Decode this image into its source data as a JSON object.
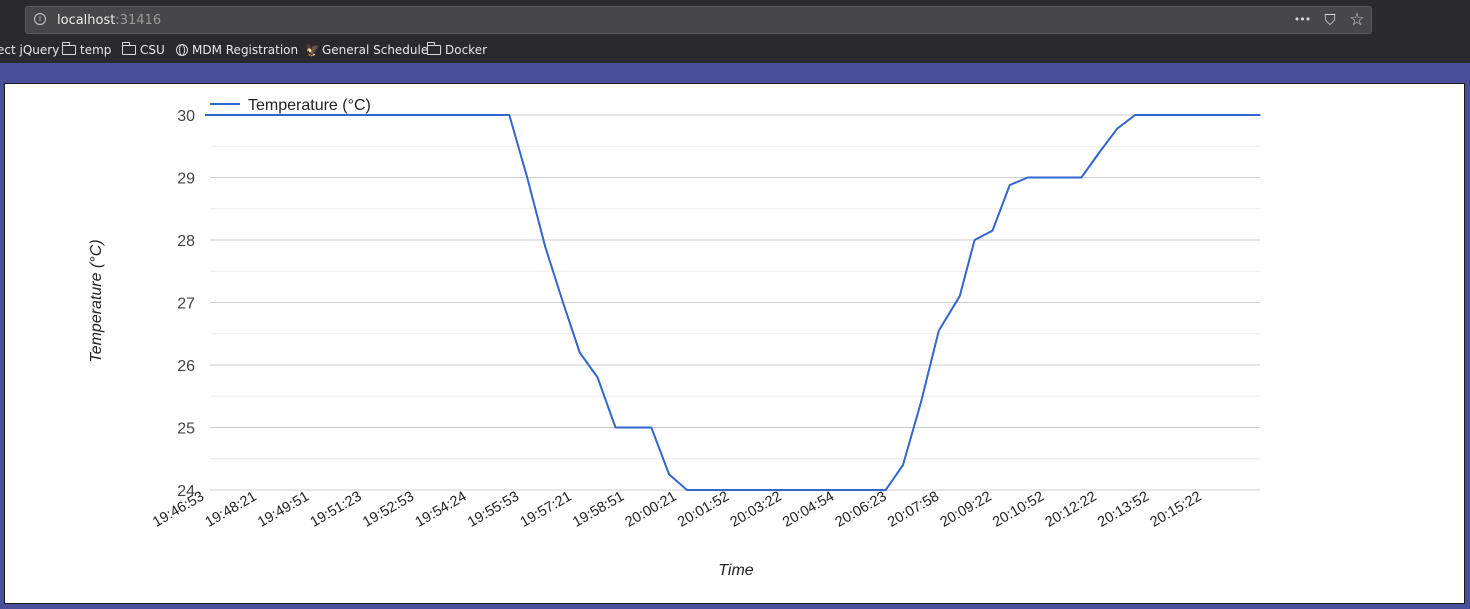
{
  "browser": {
    "url_host": "localhost",
    "url_port": ":31416",
    "menu_glyph": "•••",
    "pocket_glyph": "⛉",
    "star_glyph": "☆",
    "bookmarks": [
      {
        "label": "ect jQuery",
        "icon": "none"
      },
      {
        "label": "temp",
        "icon": "folder-icon"
      },
      {
        "label": "CSU",
        "icon": "folder-icon"
      },
      {
        "label": "MDM Registration",
        "icon": "globe-icon"
      },
      {
        "label": "General Schedule",
        "icon": "eagle-icon"
      },
      {
        "label": "Docker",
        "icon": "folder-icon"
      }
    ],
    "chrome_color": "#2a2a2e",
    "page_background": "#4a4f99"
  },
  "chart_data": {
    "type": "line",
    "title": "",
    "xlabel": "Time",
    "ylabel": "Temperature (°C)",
    "ylim": [
      24,
      30
    ],
    "yticks": [
      24,
      25,
      26,
      27,
      28,
      29,
      30
    ],
    "grid": true,
    "legend_position": "top-left",
    "x_tick_labels": [
      "19:46:53",
      "19:48:21",
      "19:49:51",
      "19:51:23",
      "19:52:53",
      "19:54:24",
      "19:55:53",
      "19:57:21",
      "19:58:51",
      "20:00:21",
      "20:01:52",
      "20:03:22",
      "20:04:54",
      "20:06:23",
      "20:07:58",
      "20:09:22",
      "20:10:52",
      "20:12:22",
      "20:13:52",
      "20:15:22"
    ],
    "series": [
      {
        "name": "Temperature (°C)",
        "color": "#3366cc",
        "points": [
          [
            "19:46:53",
            30
          ],
          [
            "19:55:23",
            30
          ],
          [
            "19:55:53",
            29
          ],
          [
            "19:56:23",
            27.9
          ],
          [
            "19:56:53",
            27
          ],
          [
            "19:57:21",
            26.2
          ],
          [
            "19:57:51",
            25.8
          ],
          [
            "19:58:21",
            25
          ],
          [
            "19:59:21",
            25
          ],
          [
            "19:59:51",
            24.25
          ],
          [
            "20:00:21",
            24
          ],
          [
            "20:05:54",
            24
          ],
          [
            "20:06:23",
            24.4
          ],
          [
            "20:06:53",
            25.4
          ],
          [
            "20:07:23",
            26.55
          ],
          [
            "20:07:58",
            27.1
          ],
          [
            "20:08:23",
            28
          ],
          [
            "20:08:53",
            28.15
          ],
          [
            "20:09:22",
            28.88
          ],
          [
            "20:09:52",
            29
          ],
          [
            "20:11:22",
            29
          ],
          [
            "20:11:52",
            29.4
          ],
          [
            "20:12:22",
            29.78
          ],
          [
            "20:12:52",
            30
          ],
          [
            "20:16:22",
            30
          ]
        ]
      }
    ]
  }
}
